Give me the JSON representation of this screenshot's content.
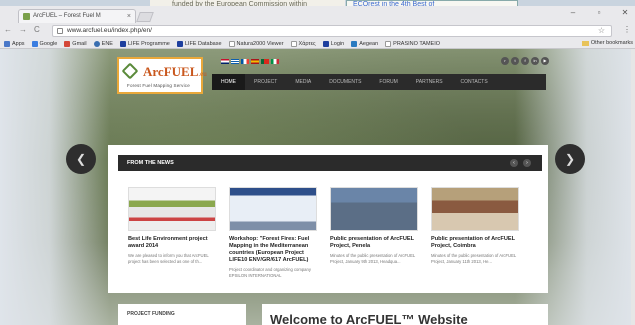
{
  "background": {
    "window1_text": "funded by the European Commission within",
    "window2_text": "ECOrest in the 4th Best of"
  },
  "browser": {
    "tab_title": "ArcFUEL – Forest Fuel M",
    "tab_close": "×",
    "url": "www.arcfuel.eu/index.php/en/",
    "bookmarks": [
      "Apps",
      "Google",
      "Gmail",
      "ENE",
      "LIFE Programme",
      "LIFE Database",
      "Natura2000 Viewer",
      "Χάρτες",
      "Login",
      "Aegean",
      "PRASINO TAMEIO"
    ],
    "other_bookmarks": "Other bookmarks"
  },
  "site": {
    "logo_name": "ArcFUEL",
    "logo_suffix": ".eu",
    "logo_tagline": "Forest Fuel Mapping Service",
    "nav": [
      "HOME",
      "PROJECT",
      "MEDIA",
      "DOCUMENTS",
      "FORUM",
      "PARTNERS",
      "CONTACTS"
    ],
    "news_title": "FROM THE NEWS",
    "news": [
      {
        "title": "Best Life Environment project award 2014",
        "text": "We are pleased to inform you that ArcFUEL project has been selected as one of th..."
      },
      {
        "title": "Workshop: \"Forest Fires: Fuel Mapping in the Mediterranean countries (European Project LIFE10 ENV/GR/617 ArcFUEL)",
        "text": "Project coordinator and organizing company EPSILON INTERNATIONAL"
      },
      {
        "title": "Public presentation of ArcFUEL Project, Penela",
        "text": "Minutes of the public presentation of ArcFUEL Project, January 9th 2013, Headqua..."
      },
      {
        "title": "Public presentation of ArcFUEL Project, Coimbra",
        "text": "Minutes of the public presentation of ArcFUEL Project, January 11th 2013, He..."
      }
    ],
    "funding_title": "PROJECT FUNDING",
    "welcome": "Welcome to ArcFUEL™ Website"
  },
  "colors": {
    "accent": "#c9571d",
    "nav_bg": "#2b2b2b",
    "logo_border": "#e9a83a"
  }
}
